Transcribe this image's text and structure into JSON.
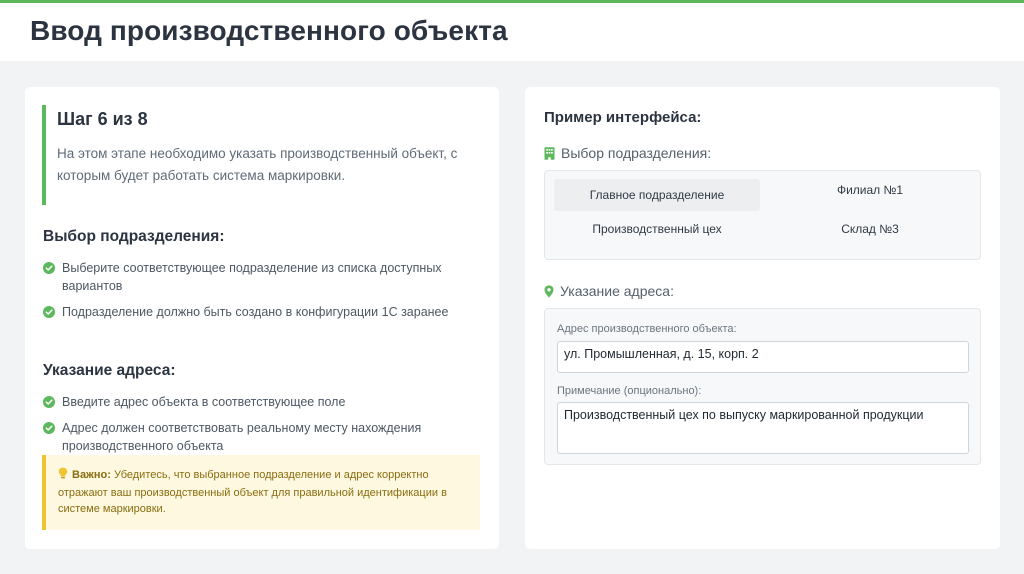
{
  "header": {
    "title": "Ввод производственного объекта"
  },
  "left": {
    "step": {
      "title": "Шаг 6 из 8",
      "text": "На этом этапе необходимо указать производственный объект, с которым будет работать система маркировки."
    },
    "section1": {
      "title": "Выбор подразделения:",
      "items": [
        "Выберите соответствующее подразделение из списка доступных вариантов",
        "Подразделение должно быть создано в конфигурации 1С заранее"
      ]
    },
    "section2": {
      "title": "Указание адреса:",
      "items": [
        "Введите адрес объекта в соответствующее поле",
        "Адрес должен соответствовать реальному месту нахождения производственного объекта"
      ]
    },
    "note": {
      "label": "Важно:",
      "text": "Убедитесь, что выбранное подразделение и адрес корректно отражают ваш производственный объект для правильной идентификации в системе маркировки."
    }
  },
  "right": {
    "title": "Пример интерфейса:",
    "division": {
      "label": "Выбор подразделения:",
      "options": [
        "Главное подразделение",
        "Филиал №1",
        "Производственный цех",
        "Склад №3"
      ],
      "selected_index": 0
    },
    "address": {
      "label": "Указание адреса:",
      "address_label": "Адрес производственного объекта:",
      "address_value": "ул. Промышленная, д. 15, корп. 2",
      "note_label": "Примечание (опционально):",
      "note_value": "Производственный цех по выпуску маркированной продукции"
    }
  },
  "colors": {
    "accent": "#5cb85c",
    "warning_border": "#f0c330",
    "warning_bg": "#fdf8df"
  },
  "icons": [
    "check-icon",
    "lightbulb-icon",
    "building-icon",
    "map-pin-icon"
  ]
}
